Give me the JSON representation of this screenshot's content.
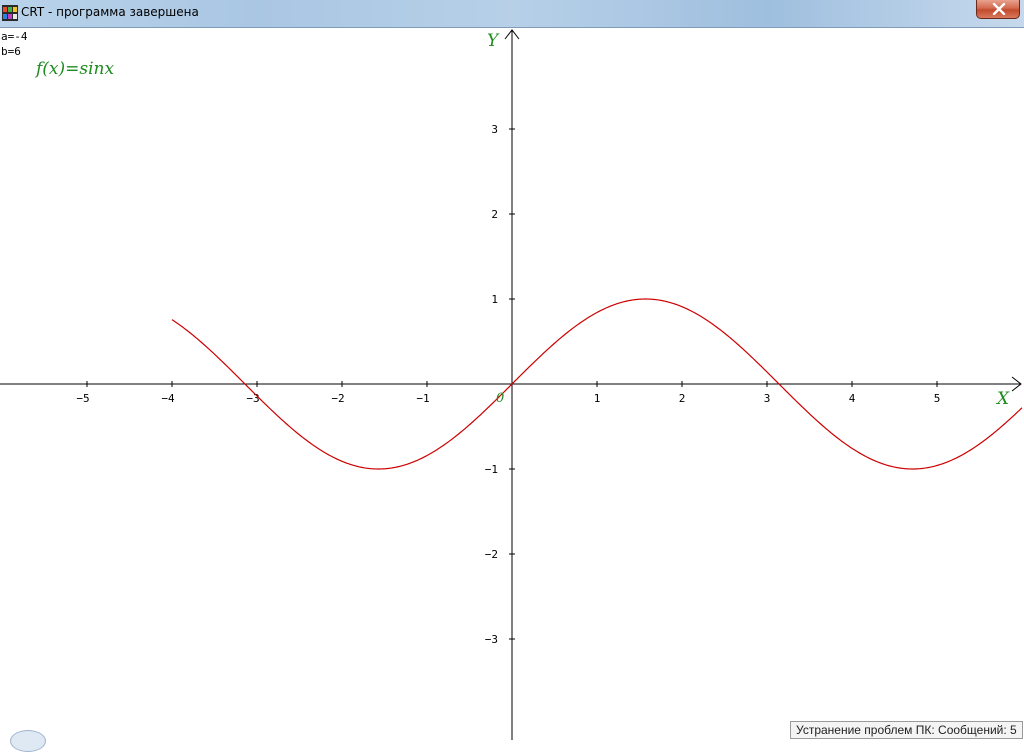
{
  "window": {
    "title": "CRT - программа завершена",
    "icon": "crt-app-icon",
    "close_icon": "close-icon"
  },
  "params": {
    "a_text": "a=-4",
    "b_text": "b=6"
  },
  "chart_data": {
    "type": "line",
    "title": "f(x)=sinx",
    "xlabel": "X",
    "ylabel": "Y",
    "origin_label": "0",
    "xlim": [
      -6,
      6
    ],
    "ylim": [
      -4,
      4
    ],
    "domain": [
      -4,
      6
    ],
    "function": "sin(x)",
    "x_ticks": [
      -5,
      -4,
      -3,
      -2,
      -1,
      1,
      2,
      3,
      4,
      5
    ],
    "y_ticks": [
      -3,
      -2,
      -1,
      1,
      2,
      3
    ],
    "grid": false,
    "series": [
      {
        "color": "#cc0000",
        "x": [
          -4,
          -3.5,
          -3,
          -2.5,
          -2,
          -1.5708,
          -1,
          -0.5,
          0,
          0.5,
          1,
          1.5708,
          2,
          2.5,
          3,
          3.5,
          4,
          4.5,
          4.7124,
          5,
          5.5,
          6
        ],
        "y": [
          0.757,
          0.351,
          -0.141,
          -0.598,
          -0.909,
          -1,
          -0.841,
          -0.479,
          0,
          0.479,
          0.841,
          1,
          0.909,
          0.598,
          0.141,
          -0.351,
          -0.757,
          -0.978,
          -1,
          -0.959,
          -0.706,
          -0.279
        ]
      }
    ],
    "colors": {
      "axes": "#000000",
      "curve": "#cc0000",
      "labels": "#1e8c1e",
      "ticks": "#000000"
    }
  },
  "taskbar": {
    "notification": "Устранение проблем ПК: Сообщений: 5"
  }
}
